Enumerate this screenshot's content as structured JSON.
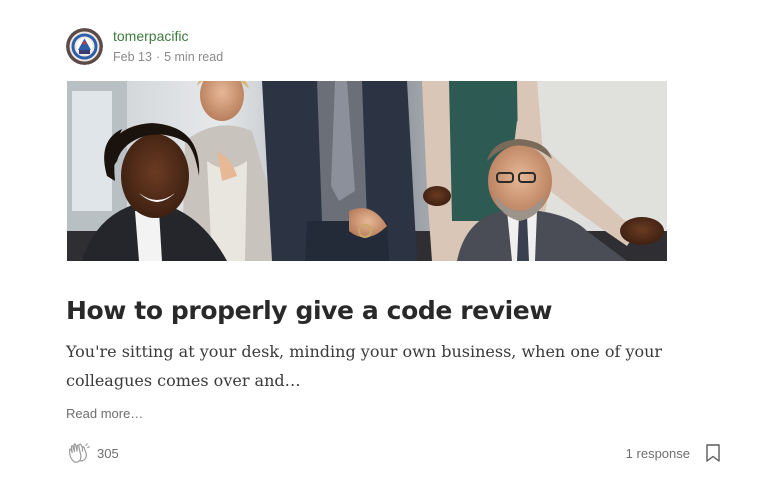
{
  "author": {
    "name": "tomerpacific",
    "date": "Feb 13",
    "separator": "·",
    "read_time": "5 min read",
    "avatar_icon": "circular-logo-avatar"
  },
  "post": {
    "title": "How to properly give a code review",
    "excerpt": "You're sitting at your desk, minding your own business, when one of your colleagues comes over and…",
    "read_more": "Read more…",
    "hero_image": "office-meeting-photo"
  },
  "footer": {
    "claps": "305",
    "responses": "1 response",
    "clap_icon": "clap-hands-icon",
    "bookmark_icon": "bookmark-icon"
  },
  "colors": {
    "author_name": "#3e7a3e",
    "title": "#292929",
    "meta": "#8a8a8a"
  }
}
